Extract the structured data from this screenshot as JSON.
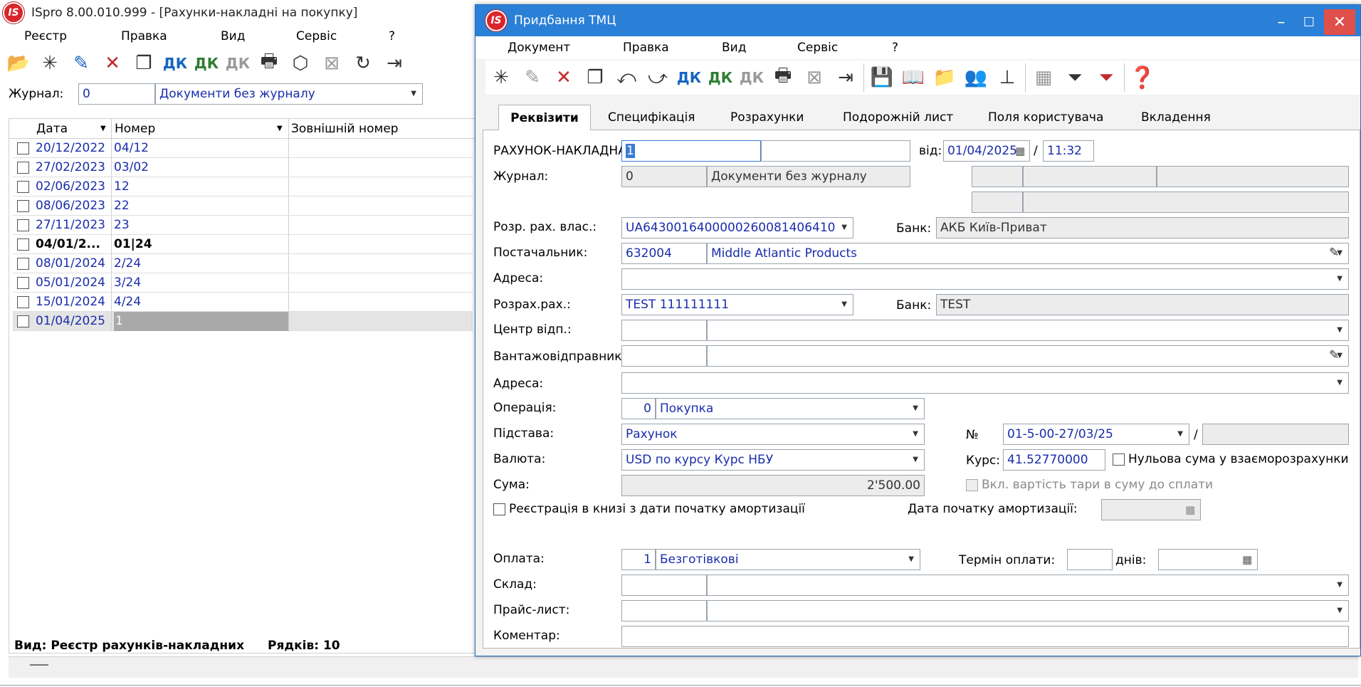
{
  "left": {
    "title": "ISpro 8.00.010.999 - [Рахунки-накладні на покупку]",
    "menu": [
      "Реєстр",
      "Правка",
      "Вид",
      "Сервіс",
      "?"
    ],
    "journal_label": "Журнал:",
    "journal_code": "0",
    "journal_name": "Документи без журналу",
    "columns": [
      "Дата",
      "Номер",
      "Зовнішній номер"
    ],
    "rows": [
      {
        "date": "20/12/2022",
        "num": "04/12"
      },
      {
        "date": "27/02/2023",
        "num": "03/02"
      },
      {
        "date": "02/06/2023",
        "num": "12"
      },
      {
        "date": "08/06/2023",
        "num": "22"
      },
      {
        "date": "27/11/2023",
        "num": "23"
      },
      {
        "date": "04/01/2...",
        "num": "01|24"
      },
      {
        "date": "08/01/2024",
        "num": "2/24"
      },
      {
        "date": "05/01/2024",
        "num": "3/24"
      },
      {
        "date": "15/01/2024",
        "num": "4/24"
      },
      {
        "date": "01/04/2025",
        "num": "1"
      }
    ],
    "status_view": "Вид: Реєстр рахунків-накладних",
    "status_rows": "Рядків: 10"
  },
  "right": {
    "title": "Придбання ТМЦ",
    "menu": [
      "Документ",
      "Правка",
      "Вид",
      "Сервіс",
      "?"
    ],
    "tabs": [
      "Реквізити",
      "Специфікація",
      "Розрахунки",
      "Подорожній лист",
      "Поля користувача",
      "Вкладення"
    ],
    "labels": {
      "invoice_no": "РАХУНОК-НАКЛАДНА №:",
      "from": "від:",
      "slash": "/",
      "journal": "Журнал:",
      "own_account": "Розр. рах. влас.:",
      "bank": "Банк:",
      "supplier": "Постачальник:",
      "address": "Адреса:",
      "supplier_account": "Розрах.рах.:",
      "resp_center": "Центр відп.:",
      "shipper": "Вантажовідправник:",
      "address2": "Адреса:",
      "operation": "Операція:",
      "basis": "Підстава:",
      "no": "№",
      "currency": "Валюта:",
      "rate": "Курс:",
      "zero_sum": "Нульова сума у взаєморозрахунки",
      "sum": "Сума:",
      "tare": "Вкл. вартість тари в суму до сплати",
      "registration": "Реєстрація в книзі з дати початку амортизації",
      "amort_date": "Дата початку амортизації:",
      "payment": "Оплата:",
      "pay_term": "Термін оплати:",
      "days": "днів:",
      "warehouse": "Склад:",
      "price_list": "Прайс-лист:",
      "comment": "Коментар:"
    },
    "values": {
      "invoice_no": "1",
      "date": "01/04/2025",
      "time": "11:32",
      "journal_code": "0",
      "journal_name": "Документи без журналу",
      "own_account": "UA6430016400000260081406410",
      "own_bank": "АКБ Київ-Приват",
      "supplier_code": "632004",
      "supplier_name": "Middle Atlantic Products",
      "supplier_account": "TEST 111111111",
      "supplier_bank": "TEST",
      "operation_code": "0",
      "operation_name": "Покупка",
      "basis": "Рахунок",
      "basis_no": "01-5-00-27/03/25",
      "currency": "USD по курсу Курс НБУ",
      "rate": "41.52770000",
      "sum": "2'500.00",
      "payment_code": "1",
      "payment_name": "Безготівкові"
    }
  }
}
